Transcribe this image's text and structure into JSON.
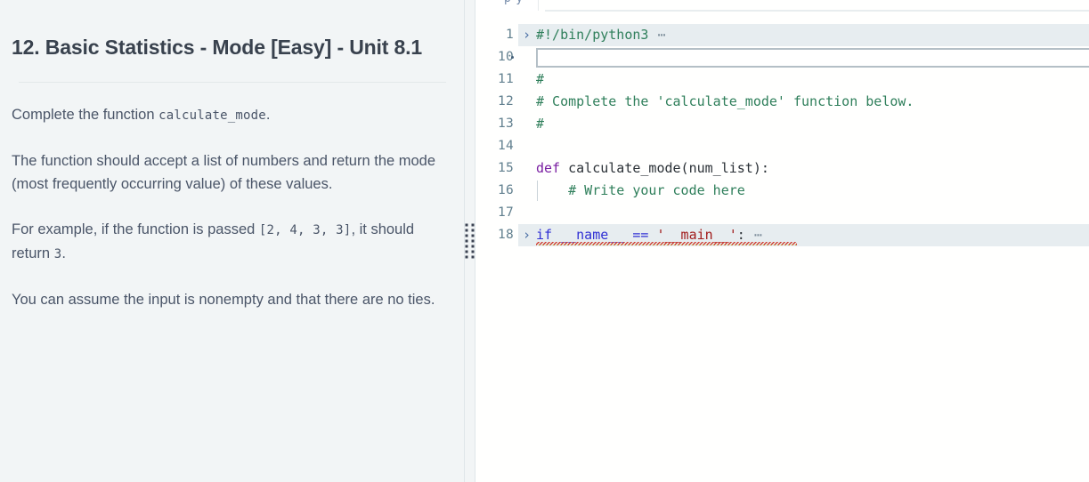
{
  "problem": {
    "title": "12. Basic Statistics - Mode [Easy] - Unit 8.1",
    "paragraphs": [
      {
        "segments": [
          {
            "type": "text",
            "value": "Complete the function "
          },
          {
            "type": "code",
            "value": "calculate_mode"
          },
          {
            "type": "text",
            "value": "."
          }
        ]
      },
      {
        "segments": [
          {
            "type": "text",
            "value": "The function should accept a list of numbers and return the mode (most frequently occurring value) of these values."
          }
        ]
      },
      {
        "segments": [
          {
            "type": "text",
            "value": "For example, if the function is passed "
          },
          {
            "type": "code",
            "value": "[2, 4, 3, 3]"
          },
          {
            "type": "text",
            "value": ", it should return "
          },
          {
            "type": "code",
            "value": "3"
          },
          {
            "type": "text",
            "value": "."
          }
        ]
      },
      {
        "segments": [
          {
            "type": "text",
            "value": "You can assume the input is nonempty and that there are no ties."
          }
        ]
      }
    ]
  },
  "splitter": {
    "label": "resize-handle",
    "dot_count": 14
  },
  "editor": {
    "tab_ghost_text": "py",
    "fold_chevron": "›",
    "fold_ellipsis": "⋯",
    "lines": [
      {
        "number": "1",
        "folded": true,
        "has_fold_marker": true,
        "tokens": [
          {
            "cls": "tok-comment",
            "text": "#!/bin/python3"
          },
          {
            "cls": "tok-ellipsis",
            "text": " ⋯"
          }
        ]
      },
      {
        "number": "10",
        "folded": false,
        "has_fold_marker": false,
        "widget": true,
        "tokens": []
      },
      {
        "number": "11",
        "folded": false,
        "has_fold_marker": false,
        "tokens": [
          {
            "cls": "tok-comment",
            "text": "#"
          }
        ]
      },
      {
        "number": "12",
        "folded": false,
        "has_fold_marker": false,
        "tokens": [
          {
            "cls": "tok-comment",
            "text": "# Complete the 'calculate_mode' function below."
          }
        ]
      },
      {
        "number": "13",
        "folded": false,
        "has_fold_marker": false,
        "tokens": [
          {
            "cls": "tok-comment",
            "text": "#"
          }
        ]
      },
      {
        "number": "14",
        "folded": false,
        "has_fold_marker": false,
        "tokens": []
      },
      {
        "number": "15",
        "folded": false,
        "has_fold_marker": false,
        "tokens": [
          {
            "cls": "tok-def",
            "text": "def"
          },
          {
            "cls": "tok-plain",
            "text": " calculate_mode(num_list):"
          }
        ]
      },
      {
        "number": "16",
        "folded": false,
        "has_fold_marker": false,
        "indent_guide": true,
        "tokens": [
          {
            "cls": "tok-comment",
            "text": "    # Write your code here"
          }
        ]
      },
      {
        "number": "17",
        "folded": false,
        "has_fold_marker": false,
        "tokens": []
      },
      {
        "number": "18",
        "folded": true,
        "has_fold_marker": true,
        "error": true,
        "tokens": [
          {
            "cls": "tok-keyword",
            "text": "if"
          },
          {
            "cls": "tok-plain",
            "text": " "
          },
          {
            "cls": "tok-keyword",
            "text": "__name__"
          },
          {
            "cls": "tok-plain",
            "text": " "
          },
          {
            "cls": "tok-op",
            "text": "=="
          },
          {
            "cls": "tok-plain",
            "text": " "
          },
          {
            "cls": "tok-string",
            "text": "'__main__'"
          },
          {
            "cls": "tok-plain",
            "text": ":"
          },
          {
            "cls": "tok-ellipsis",
            "text": " ⋯"
          }
        ]
      }
    ]
  }
}
